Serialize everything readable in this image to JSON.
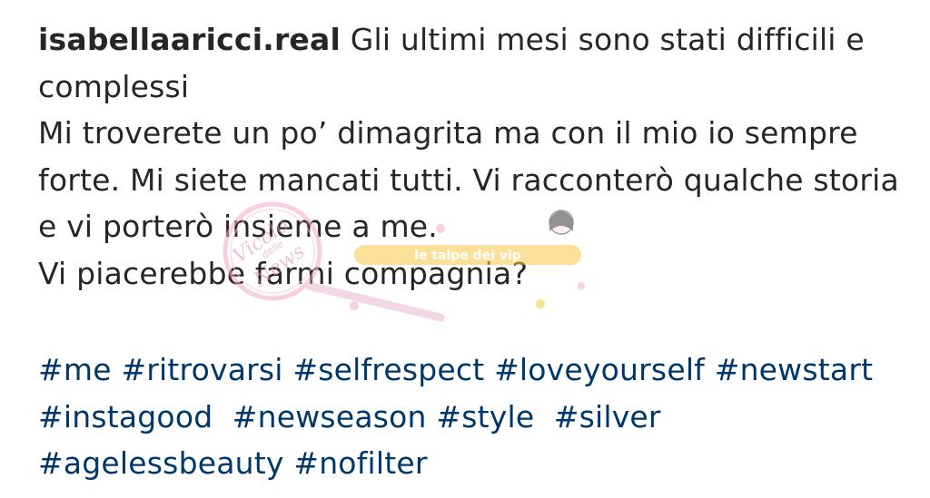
{
  "post": {
    "username": "isabellaaricci.real",
    "caption_lines": [
      "Gli ultimi mesi sono stati difficili e complessi",
      "Mi troverete un po’ dimagrita ma con il mio io sempre forte. Mi siete mancati tutti. Vi racconterò qualche storia e vi porterò insieme a me.",
      "Vi piacerebbe farmi compagnia?"
    ],
    "hashtags": [
      "#me",
      "#ritrovarsi",
      "#selfrespect",
      "#loveyourself",
      "#newstart",
      "#instagood",
      "#newseason",
      "#style",
      "#silver",
      "#agelessbeauty",
      "#nofilter"
    ]
  },
  "colors": {
    "text": "#262626",
    "hashtag": "#00376b",
    "watermark_pink": "#f2a9c8",
    "watermark_yellow": "#f6c845"
  },
  "watermark": {
    "logo_text": "Vicolo delle News",
    "banner_text": "le talpe dei vip"
  }
}
